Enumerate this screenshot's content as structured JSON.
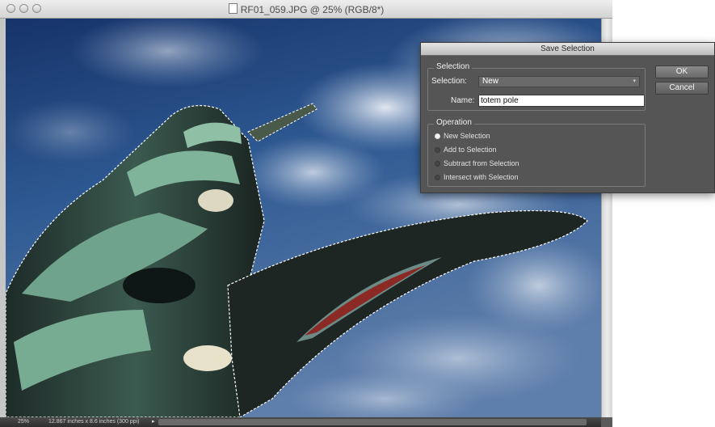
{
  "window": {
    "title": "RF01_059.JPG @ 25% (RGB/8*)"
  },
  "statusbar": {
    "zoom": "25%",
    "doc_info": "12.867 inches x 8.6 inches (300 ppi)",
    "arrow": "▸"
  },
  "dialog": {
    "title": "Save Selection",
    "ok_label": "OK",
    "cancel_label": "Cancel",
    "selection_group": {
      "legend": "Selection",
      "selection_label": "Selection:",
      "selection_value": "New",
      "name_label": "Name:",
      "name_value": "totem pole"
    },
    "operation_group": {
      "legend": "Operation",
      "options": [
        {
          "label": "New Selection",
          "selected": true
        },
        {
          "label": "Add to Selection",
          "selected": false
        },
        {
          "label": "Subtract from Selection",
          "selected": false
        },
        {
          "label": "Intersect with Selection",
          "selected": false
        }
      ]
    }
  },
  "colors": {
    "sky_dark": "#1f3f78",
    "sky_light": "#8fa6c4",
    "totem_green": "#7fb39a",
    "totem_dark": "#1c2624",
    "dialog_bg": "#555555"
  }
}
